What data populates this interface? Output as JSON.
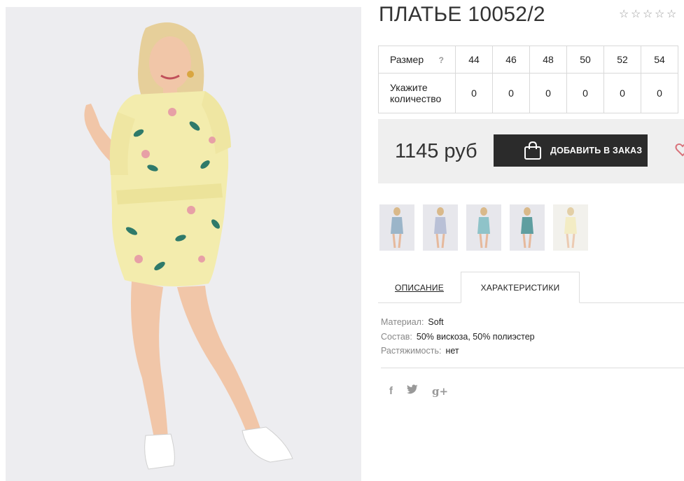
{
  "product": {
    "title": "ПЛАТЬЕ 10052/2",
    "rating_stars": [
      "☆",
      "☆",
      "☆",
      "☆",
      "☆"
    ]
  },
  "size_table": {
    "size_label": "Размер",
    "help_label": "?",
    "sizes": [
      "44",
      "46",
      "48",
      "50",
      "52",
      "54"
    ],
    "qty_label": "Укажите количество",
    "quantities": [
      "0",
      "0",
      "0",
      "0",
      "0",
      "0"
    ]
  },
  "purchase": {
    "price": "1145 руб",
    "add_button_label": "ДОБАВИТЬ В ЗАКАЗ"
  },
  "tabs": {
    "description_label": "ОПИСАНИЕ",
    "characteristics_label": "ХАРАКТЕРИСТИКИ",
    "active": "characteristics"
  },
  "characteristics": [
    {
      "key": "Материал:",
      "value": "Soft"
    },
    {
      "key": "Состав:",
      "value": "50% вискоза, 50% полиэстер"
    },
    {
      "key": "Растяжимость:",
      "value": "нет"
    }
  ],
  "social": {
    "facebook": "f",
    "twitter": "🐦",
    "google_plus": "g+"
  },
  "colors": {
    "button_bg": "#2b2b2b",
    "price_box_bg": "#efefef",
    "dress_yellow": "#f3ecad",
    "heart": "#d9727a"
  }
}
